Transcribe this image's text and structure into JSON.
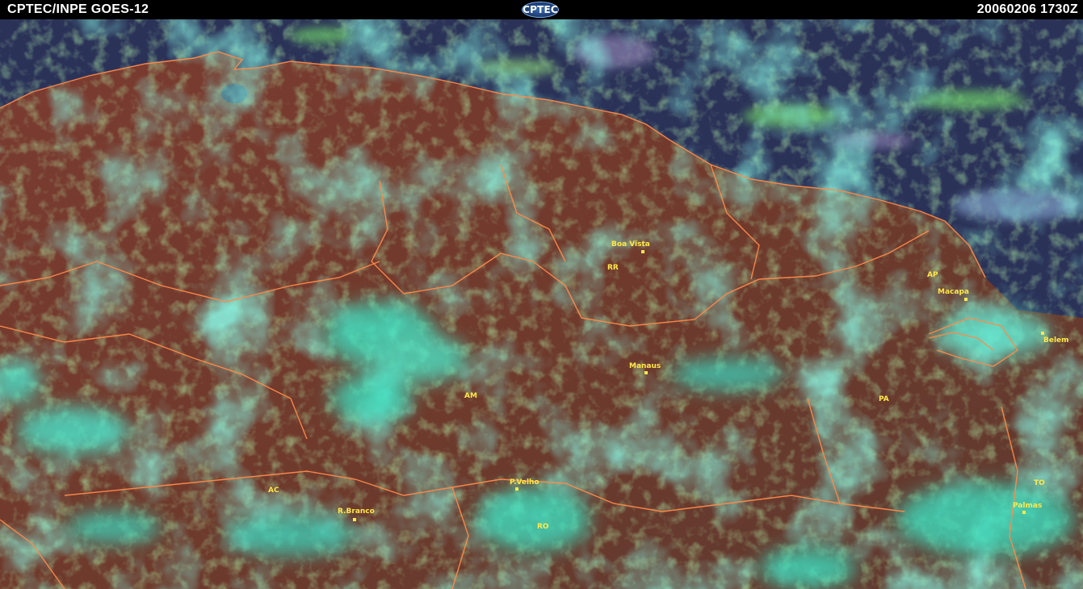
{
  "header": {
    "source": "CPTEC/INPE  GOES-12",
    "logo_text": "CPTEC",
    "timestamp": "20060206  1730Z"
  },
  "colors": {
    "ocean": "#2b3258",
    "land": "#7a3a2e",
    "vegetation_haze": "#6fd06a",
    "cloud": "#3af0c8",
    "border": "#ff8a4a",
    "label": "#ffe94a"
  },
  "labels": {
    "states": {
      "rr": "RR",
      "ap": "AP",
      "am": "AM",
      "pa": "PA",
      "ac": "AC",
      "ro": "RO",
      "to": "TO"
    },
    "cities": {
      "boa_vista": "Boa Vista",
      "macapa": "Macapa",
      "belem": "Belem",
      "manaus": "Manaus",
      "p_velho": "P.Velho",
      "r_branco": "R.Branco",
      "palmas": "Palmas"
    }
  }
}
